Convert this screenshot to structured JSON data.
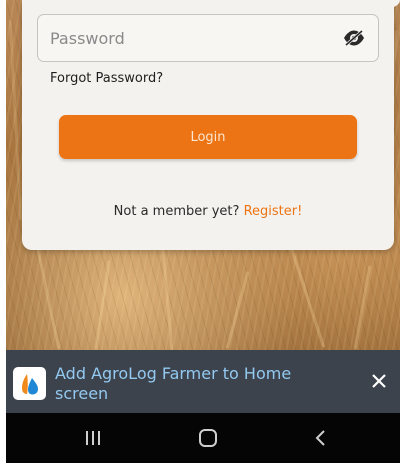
{
  "login_card": {
    "password_placeholder": "Password",
    "password_value": "",
    "forgot_password_label": "Forgot Password?",
    "login_button_label": "Login",
    "register_prompt": "Not a member yet?",
    "register_link_label": "Register!"
  },
  "install_banner": {
    "message": "Add AgroLog Farmer to Home screen",
    "app_icon": "agrolog-app-icon",
    "close_icon": "close-icon"
  },
  "navigation_bar": {
    "buttons": [
      "recent-apps-icon",
      "home-icon",
      "back-icon"
    ]
  },
  "colors": {
    "accent": "#ec7414",
    "banner_background": "#3d434d",
    "banner_text": "#93c9f0",
    "card_background": "#f4f2ee",
    "navbar_background": "#050505"
  }
}
